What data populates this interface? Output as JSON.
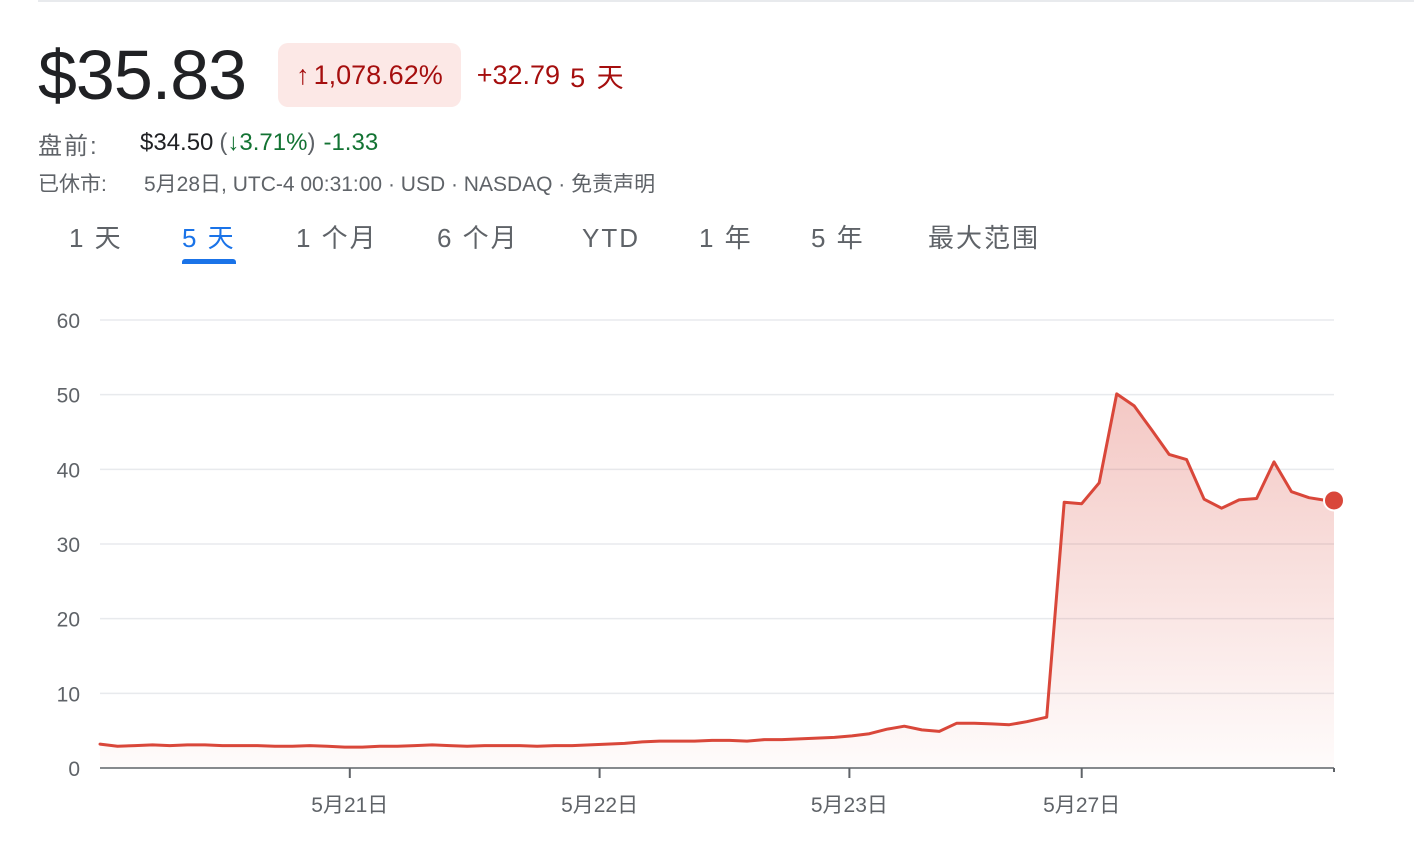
{
  "quote": {
    "price": "$35.83",
    "change_arrow": "↑",
    "change_percent": "1,078.62%",
    "change_value": "+32.79",
    "change_period": "5 天"
  },
  "premarket": {
    "label": "盘前:",
    "price": "$34.50",
    "open_paren": "(",
    "arrow": "↓",
    "percent": "3.71%",
    "close_paren": ")",
    "change": "-1.33"
  },
  "status": {
    "label": "已休市:",
    "details": "5月28日, UTC-4 00:31:00 · USD · NASDAQ · 免责声明"
  },
  "tabs": [
    {
      "label": "1 天",
      "active": false
    },
    {
      "label": "5 天",
      "active": true
    },
    {
      "label": "1 个月",
      "active": false
    },
    {
      "label": "6 个月",
      "active": false
    },
    {
      "label": "YTD",
      "active": false
    },
    {
      "label": "1 年",
      "active": false
    },
    {
      "label": "5 年",
      "active": false
    },
    {
      "label": "最大范围",
      "active": false
    }
  ],
  "colors": {
    "up": "#a50e0e",
    "up_bg": "#fce8e6",
    "down": "#137333",
    "line": "#d9473a",
    "tab_active": "#1a73e8"
  },
  "chart_data": {
    "type": "area",
    "ylim": [
      0,
      60
    ],
    "yticks": [
      "0",
      "10",
      "20",
      "30",
      "40",
      "50",
      "60"
    ],
    "xlim": [
      0,
      4.94
    ],
    "xticks": [
      {
        "x": 1,
        "label": "5月21日"
      },
      {
        "x": 2,
        "label": "5月22日"
      },
      {
        "x": 3,
        "label": "5月23日"
      },
      {
        "x": 3.93,
        "label": "5月27日"
      }
    ],
    "grid": true,
    "x": [
      0,
      0.07,
      0.14,
      0.21,
      0.28,
      0.35,
      0.42,
      0.49,
      0.56,
      0.63,
      0.7,
      0.77,
      0.84,
      0.91,
      0.98,
      1.05,
      1.12,
      1.19,
      1.26,
      1.33,
      1.4,
      1.47,
      1.54,
      1.61,
      1.68,
      1.75,
      1.82,
      1.89,
      1.96,
      2.03,
      2.1,
      2.17,
      2.24,
      2.31,
      2.38,
      2.45,
      2.52,
      2.59,
      2.66,
      2.73,
      2.8,
      2.87,
      2.94,
      3.01,
      3.08,
      3.15,
      3.22,
      3.29,
      3.36,
      3.43,
      3.5,
      3.57,
      3.64,
      3.71,
      3.79,
      3.86,
      3.93,
      4.0,
      4.07,
      4.14,
      4.21,
      4.28,
      4.35,
      4.42,
      4.49,
      4.56,
      4.63,
      4.7,
      4.77,
      4.84,
      4.91,
      4.94
    ],
    "values": [
      3.2,
      2.9,
      3.0,
      3.1,
      3.0,
      3.1,
      3.1,
      3.0,
      3.0,
      3.0,
      2.9,
      2.9,
      3.0,
      2.9,
      2.8,
      2.8,
      2.9,
      2.9,
      3.0,
      3.1,
      3.0,
      2.9,
      3.0,
      3.0,
      3.0,
      2.9,
      3.0,
      3.0,
      3.1,
      3.2,
      3.3,
      3.5,
      3.6,
      3.6,
      3.6,
      3.7,
      3.7,
      3.6,
      3.8,
      3.8,
      3.9,
      4.0,
      4.1,
      4.3,
      4.6,
      5.2,
      5.6,
      5.1,
      4.9,
      6.0,
      6.0,
      5.9,
      5.8,
      6.2,
      6.8,
      35.6,
      35.4,
      38.2,
      50.1,
      48.5,
      45.3,
      42.0,
      41.3,
      36.0,
      34.8,
      35.9,
      36.1,
      41.0,
      37.0,
      36.2,
      35.83,
      35.83
    ]
  }
}
